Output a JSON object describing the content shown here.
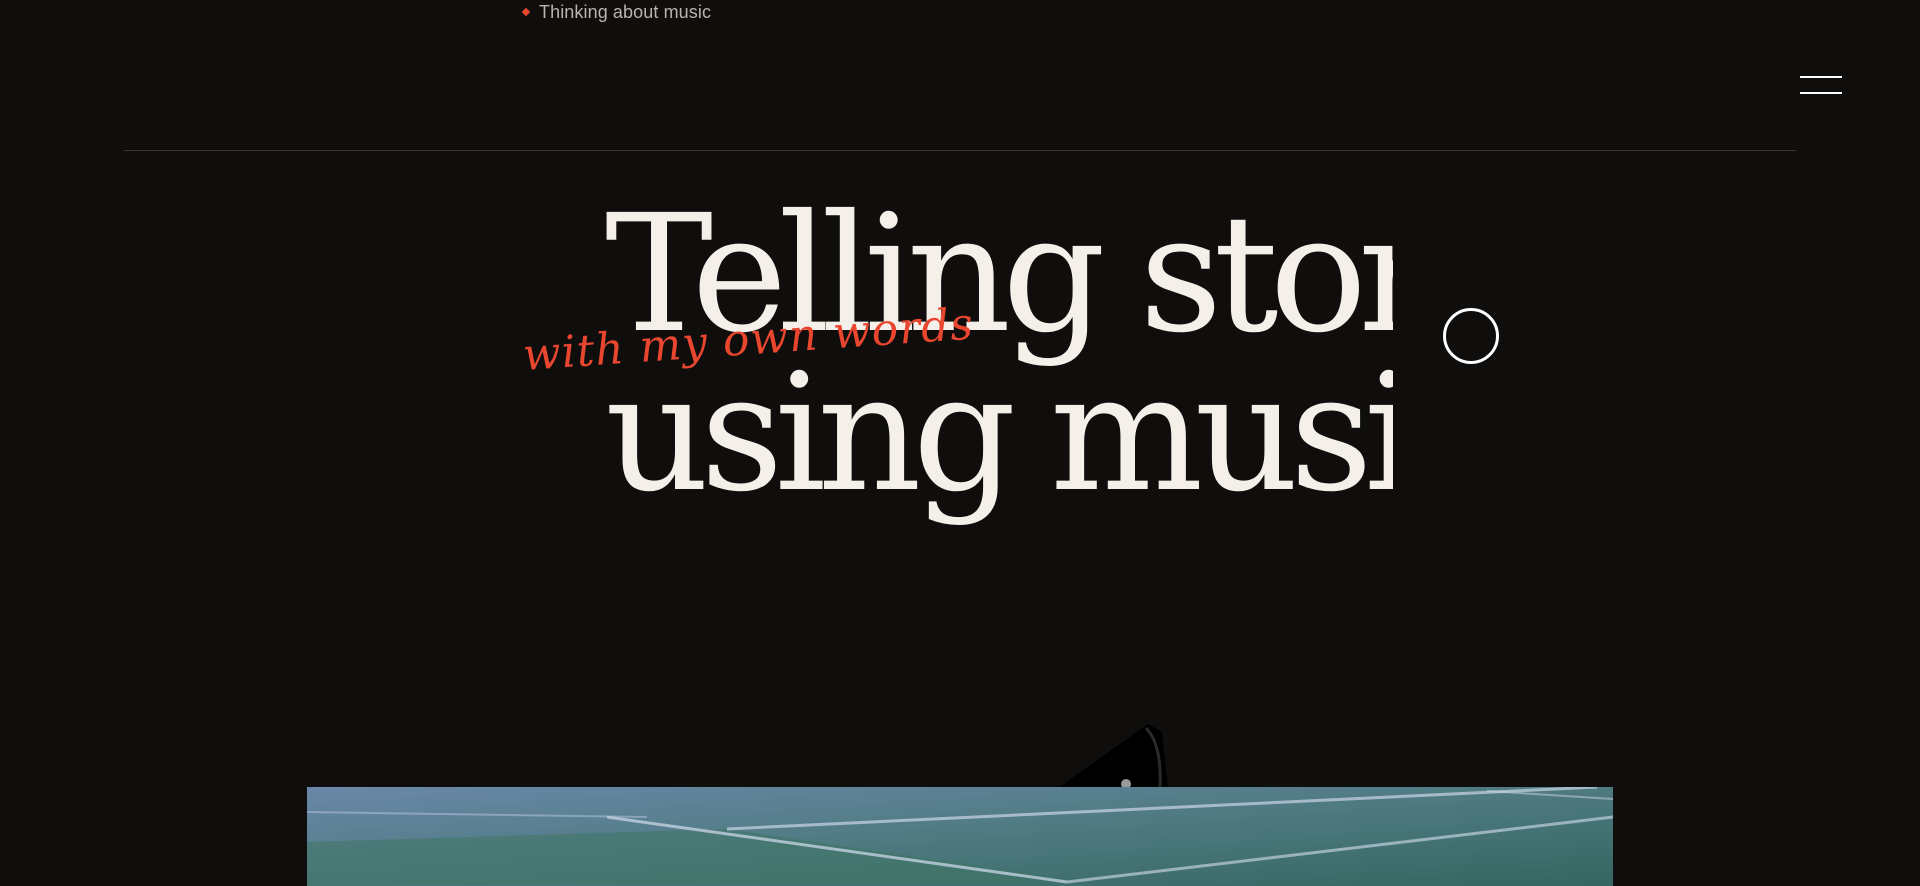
{
  "header": {
    "tagline": "Thinking about music",
    "accent_color": "#e8462e",
    "menu_icon": "hamburger-icon"
  },
  "hero": {
    "headline_line_1": "Telling storie",
    "headline_line_2": "using music",
    "script_text": "with my own words",
    "circle_button_icon": "circle-icon"
  },
  "media": {
    "photo_subject": "turntable-photo"
  }
}
